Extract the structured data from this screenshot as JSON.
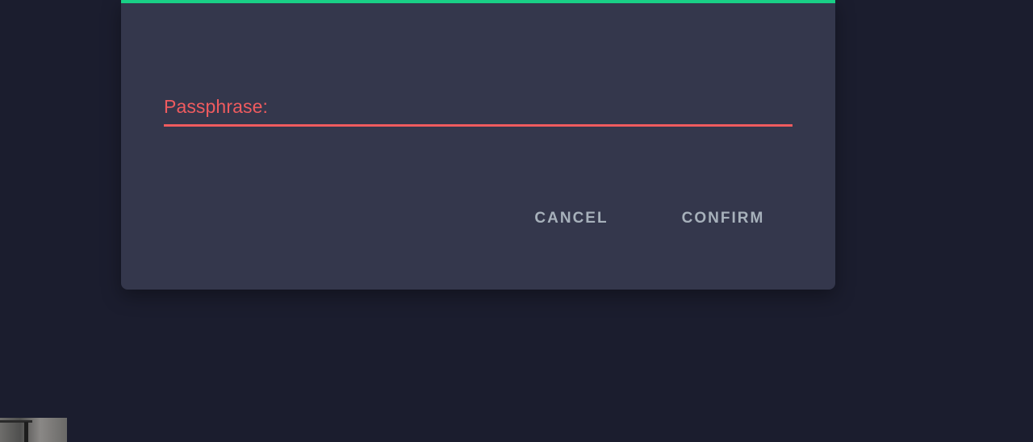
{
  "dialog": {
    "accent_color": "#19cf86",
    "background_color": "#34374c",
    "passphrase_field": {
      "label": "Passphrase:",
      "value": "",
      "state": "error",
      "error_color": "#ef5b5f"
    },
    "cancel_label": "CANCEL",
    "confirm_label": "CONFIRM"
  },
  "page_background_color": "#1b1d2e",
  "thumbnail": {
    "semantic": "webcam-preview-thumbnail"
  }
}
